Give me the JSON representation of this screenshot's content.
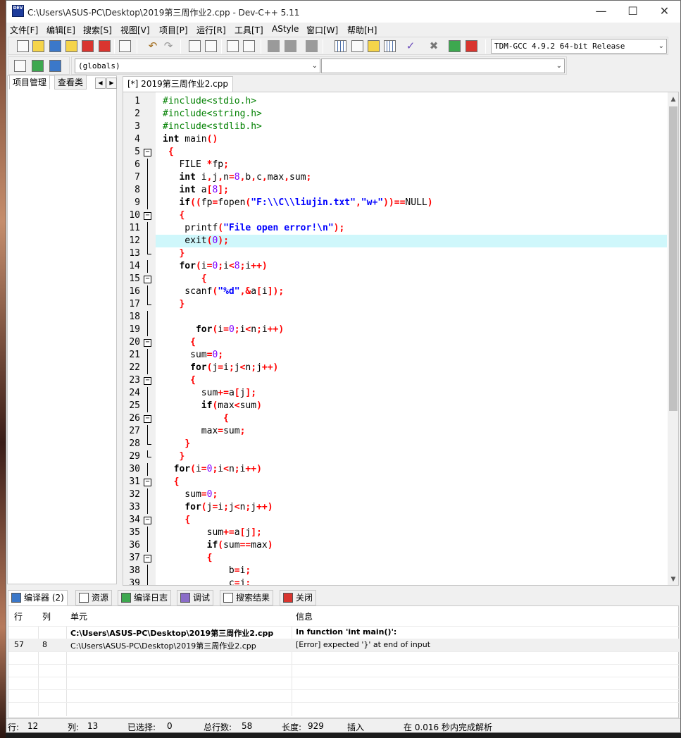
{
  "window": {
    "title": "C:\\Users\\ASUS-PC\\Desktop\\2019第三周作业2.cpp - Dev-C++ 5.11",
    "icon_label": "DEV",
    "minimize": "—",
    "maximize": "☐",
    "close": "✕"
  },
  "menu": [
    "文件[F]",
    "编辑[E]",
    "搜索[S]",
    "视图[V]",
    "项目[P]",
    "运行[R]",
    "工具[T]",
    "AStyle",
    "窗口[W]",
    "帮助[H]"
  ],
  "toolbar": {
    "compiler": "TDM-GCC 4.9.2 64-bit Release",
    "scope": "(globals)",
    "function": ""
  },
  "left_panel": {
    "tabs": [
      "项目管理",
      "查看类"
    ],
    "arrow_left": "◀",
    "arrow_right": "▶"
  },
  "editor": {
    "tab_label": "[*] 2019第三周作业2.cpp",
    "highlight_line": 12
  },
  "bottom_panel": {
    "tabs": [
      "编译器 (2)",
      "资源",
      "编译日志",
      "调试",
      "搜索结果",
      "关闭"
    ],
    "headers": [
      "行",
      "列",
      "单元",
      "信息"
    ],
    "rows": [
      {
        "line": "",
        "col": "",
        "unit": "C:\\Users\\ASUS-PC\\Desktop\\2019第三周作业2.cpp",
        "message": "In function 'int main()':"
      },
      {
        "line": "57",
        "col": "8",
        "unit": "C:\\Users\\ASUS-PC\\Desktop\\2019第三周作业2.cpp",
        "message": "[Error] expected '}' at end of input"
      }
    ]
  },
  "status": {
    "row_label": "行:",
    "row_value": "12",
    "col_label": "列:",
    "col_value": "13",
    "sel_label": "已选择:",
    "sel_value": "0",
    "lines_label": "总行数:",
    "lines_value": "58",
    "len_label": "长度:",
    "len_value": "929",
    "mode": "插入",
    "parse": "在 0.016 秒内完成解析"
  }
}
